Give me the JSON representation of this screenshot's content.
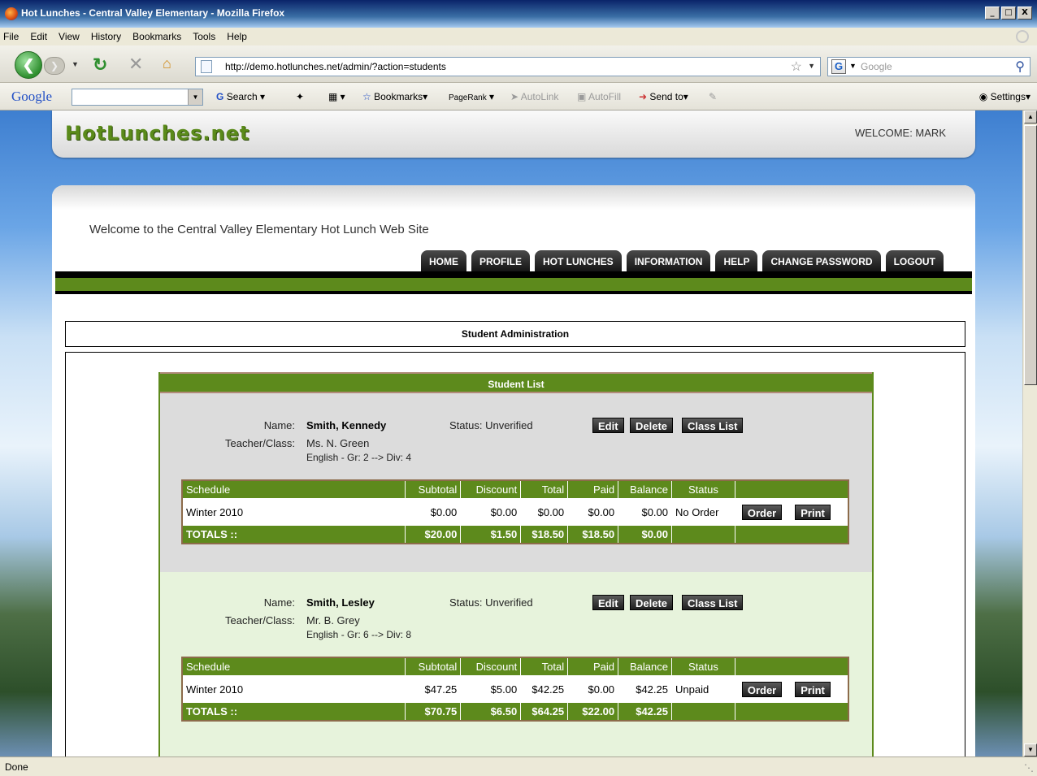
{
  "window": {
    "title": "Hot Lunches - Central Valley Elementary - Mozilla Firefox",
    "buttons": [
      "_",
      "□",
      "X"
    ]
  },
  "menu": [
    "File",
    "Edit",
    "View",
    "History",
    "Bookmarks",
    "Tools",
    "Help"
  ],
  "nav": {
    "url": "http://demo.hotlunches.net/admin/?action=students",
    "search_placeholder": "Google"
  },
  "google_toolbar": {
    "logo": "Google",
    "items": {
      "search": "Search",
      "bookmarks": "Bookmarks",
      "pagerank": "PageRank",
      "autolink": "AutoLink",
      "autofill": "AutoFill",
      "sendto": "Send to",
      "settings": "Settings"
    }
  },
  "site": {
    "logo": "HotLunches.net",
    "welcome_user": "WELCOME: MARK",
    "intro": "Welcome to the Central Valley Elementary Hot Lunch Web Site",
    "tabs": [
      "HOME",
      "PROFILE",
      "HOT LUNCHES",
      "INFORMATION",
      "HELP",
      "CHANGE PASSWORD",
      "LOGOUT"
    ],
    "section_title": "Student Administration",
    "list_title": "Student List"
  },
  "labels": {
    "name": "Name:",
    "teacher": "Teacher/Class:",
    "edit": "Edit",
    "delete": "Delete",
    "class_list": "Class List",
    "order": "Order",
    "print": "Print"
  },
  "table_headers": [
    "Schedule",
    "Subtotal",
    "Discount",
    "Total",
    "Paid",
    "Balance",
    "Status"
  ],
  "students": [
    {
      "name": "Smith, Kennedy",
      "status": "Status: Unverified",
      "teacher": "Ms. N. Green",
      "class": "English - Gr: 2 --> Div: 4",
      "row": {
        "schedule": "Winter 2010",
        "subtotal": "$0.00",
        "discount": "$0.00",
        "total": "$0.00",
        "paid": "$0.00",
        "balance": "$0.00",
        "status": "No Order"
      },
      "totals": {
        "label": "TOTALS ::",
        "subtotal": "$20.00",
        "discount": "$1.50",
        "total": "$18.50",
        "paid": "$18.50",
        "balance": "$0.00"
      }
    },
    {
      "name": "Smith, Lesley",
      "status": "Status: Unverified",
      "teacher": "Mr. B. Grey",
      "class": "English - Gr: 6 --> Div: 8",
      "row": {
        "schedule": "Winter 2010",
        "subtotal": "$47.25",
        "discount": "$5.00",
        "total": "$42.25",
        "paid": "$0.00",
        "balance": "$42.25",
        "status": "Unpaid"
      },
      "totals": {
        "label": "TOTALS ::",
        "subtotal": "$70.75",
        "discount": "$6.50",
        "total": "$64.25",
        "paid": "$22.00",
        "balance": "$42.25"
      }
    }
  ],
  "statusbar": "Done"
}
